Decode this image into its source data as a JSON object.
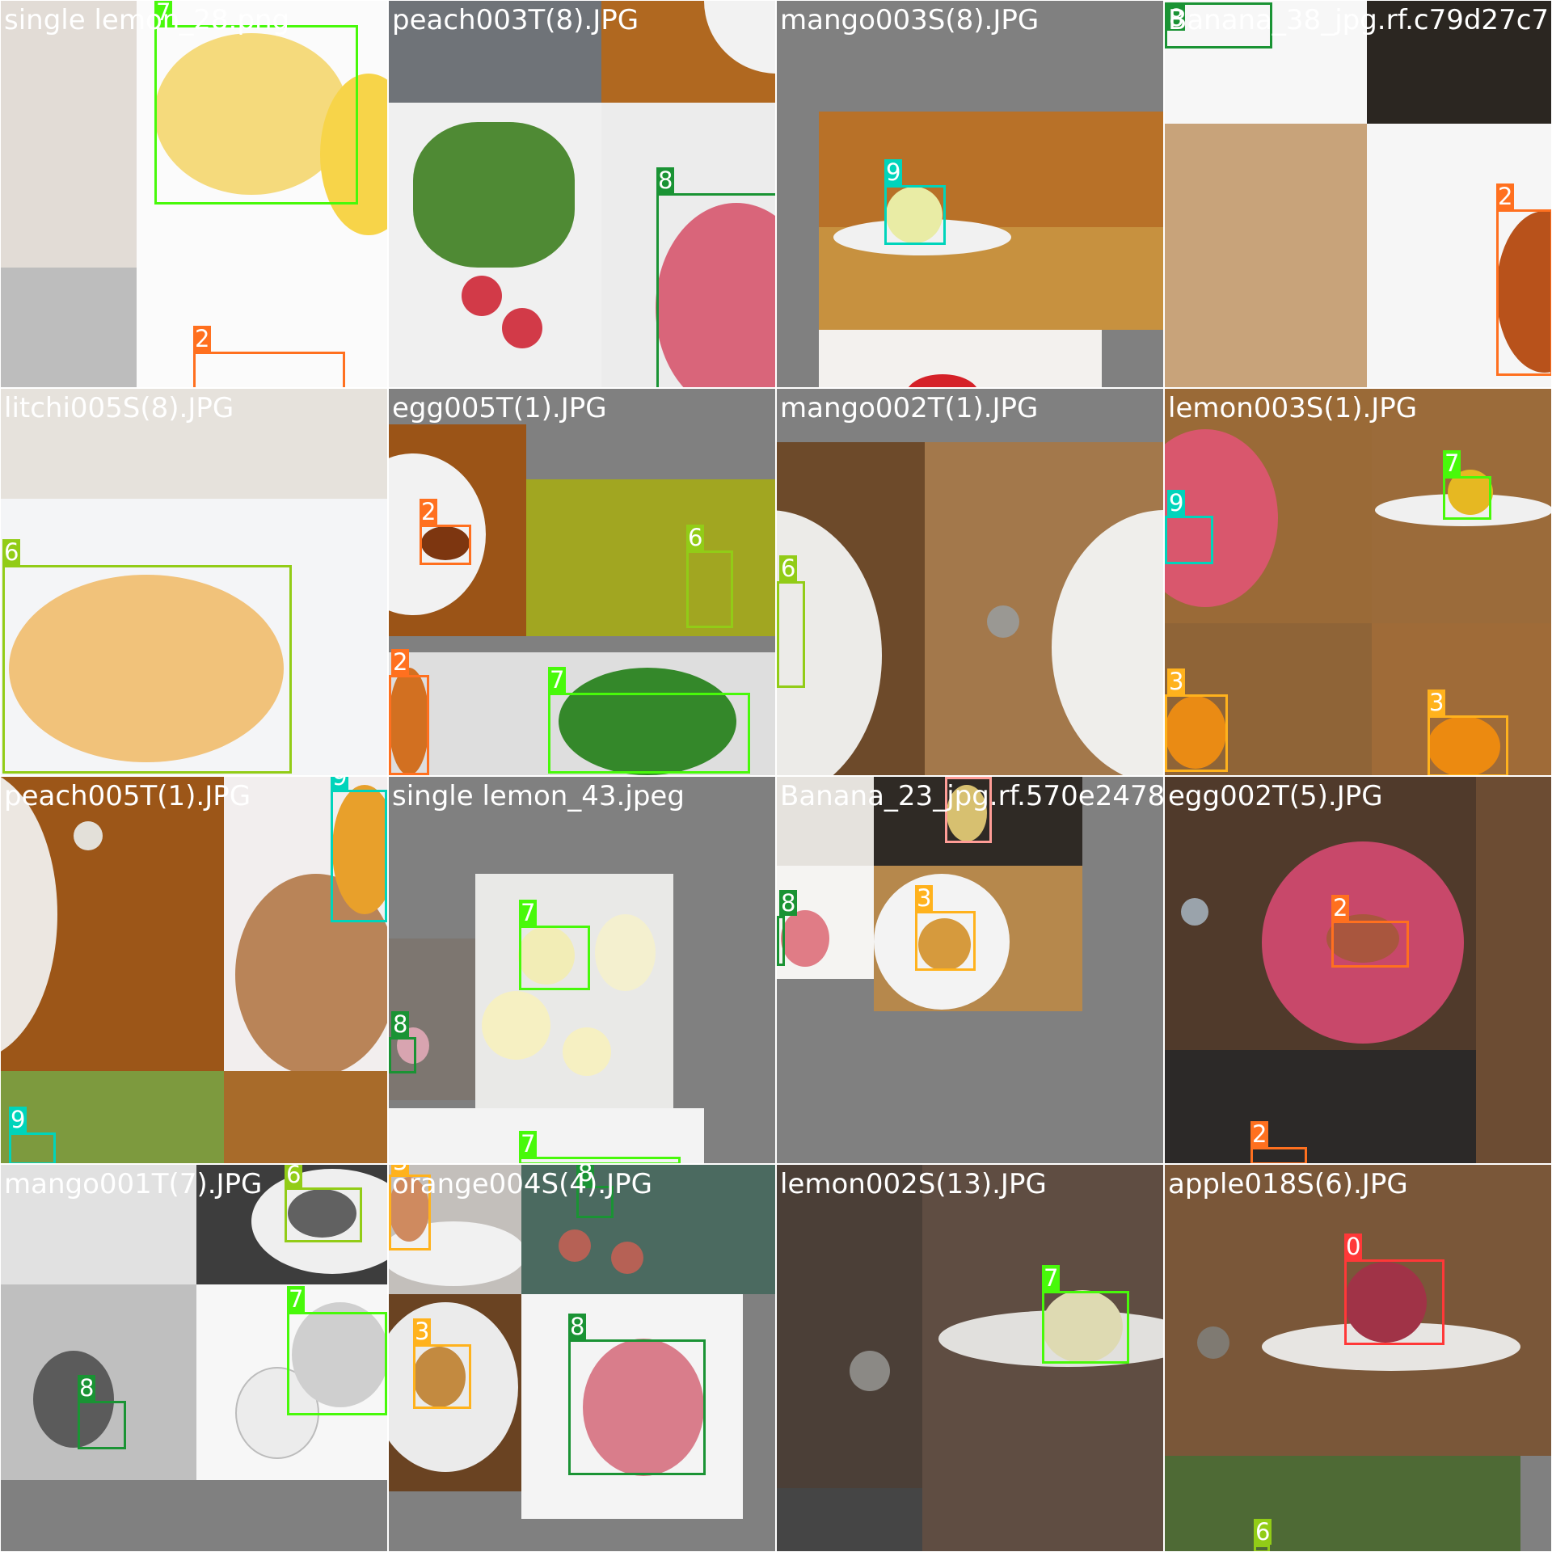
{
  "class_colors": {
    "0": "#ff3838",
    "1": "#ff9d97",
    "2": "#ff701f",
    "3": "#ffb21d",
    "6": "#92cc17",
    "7": "#48f90a",
    "8": "#1a9334",
    "9": "#00d4bb"
  },
  "tiles": [
    {
      "filename": "single lemon_28.png",
      "labels": [
        "7",
        "2"
      ]
    },
    {
      "filename": "peach003T(8).JPG",
      "labels": [
        "8"
      ]
    },
    {
      "filename": "mango003S(8).JPG",
      "labels": [
        "9"
      ]
    },
    {
      "filename": "Banana_38_jpg.rf.c79d27c7",
      "labels": [
        "8",
        "2"
      ]
    },
    {
      "filename": "litchi005S(8).JPG",
      "labels": [
        "6"
      ]
    },
    {
      "filename": "egg005T(1).JPG",
      "labels": [
        "2",
        "6",
        "2",
        "7"
      ]
    },
    {
      "filename": "mango002T(1).JPG",
      "labels": [
        "6"
      ]
    },
    {
      "filename": "lemon003S(1).JPG",
      "labels": [
        "9",
        "7",
        "3",
        "3"
      ]
    },
    {
      "filename": "peach005T(1).JPG",
      "labels": [
        "9",
        "9"
      ]
    },
    {
      "filename": "single lemon_43.jpeg",
      "labels": [
        "7",
        "8",
        "7"
      ]
    },
    {
      "filename": "Banana_23_jpg.rf.570e2478",
      "labels": [
        "1",
        "3",
        "8"
      ]
    },
    {
      "filename": "egg002T(5).JPG",
      "labels": [
        "2",
        "2"
      ]
    },
    {
      "filename": "mango001T(7).JPG",
      "labels": [
        "6",
        "7",
        "8"
      ]
    },
    {
      "filename": "orange004S(4).JPG",
      "labels": [
        "3",
        "8",
        "3",
        "8"
      ]
    },
    {
      "filename": "lemon002S(13).JPG",
      "labels": [
        "7"
      ]
    },
    {
      "filename": "apple018S(6).JPG",
      "labels": [
        "0",
        "6"
      ]
    }
  ]
}
